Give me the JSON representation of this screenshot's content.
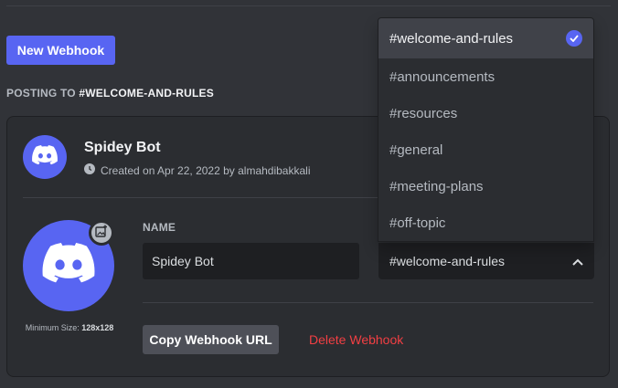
{
  "toolbar": {
    "new_webhook_label": "New Webhook"
  },
  "posting": {
    "prefix": "POSTING TO",
    "channel": "#WELCOME-AND-RULES"
  },
  "webhook": {
    "name": "Spidey Bot",
    "created": "Created on Apr 22, 2022 by almahdibakkali",
    "min_size_label": "Minimum Size:",
    "min_size_value": "128x128",
    "name_label": "NAME",
    "name_value": "Spidey Bot",
    "selected_channel": "#welcome-and-rules",
    "copy_label": "Copy Webhook URL",
    "delete_label": "Delete Webhook"
  },
  "dropdown": {
    "options": [
      "#welcome-and-rules",
      "#announcements",
      "#resources",
      "#general",
      "#meeting-plans",
      "#off-topic"
    ]
  },
  "colors": {
    "accent": "#5865f2",
    "danger": "#f23f43",
    "background": "#313338"
  }
}
